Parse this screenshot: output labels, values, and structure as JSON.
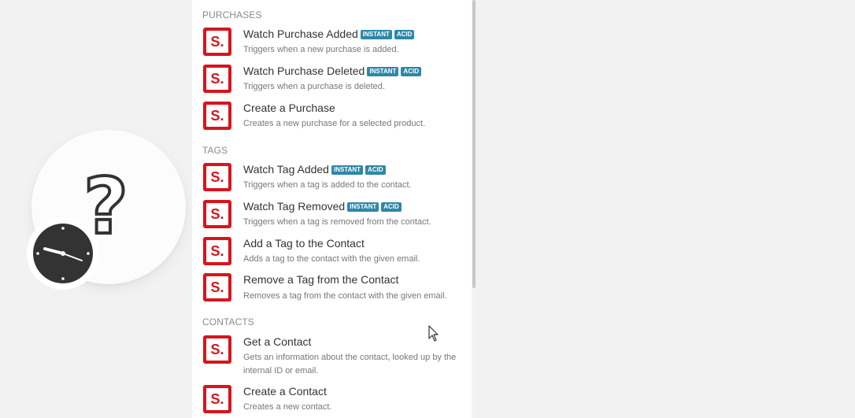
{
  "sections": {
    "purchases": "PURCHASES",
    "tags": "TAGS",
    "contacts": "CONTACTS"
  },
  "badges": {
    "instant": "INSTANT",
    "acid": "ACID"
  },
  "app_icon": {
    "glyph": "S.",
    "color": "#d9141b",
    "name": "sendfox-icon"
  },
  "modules": [
    {
      "title": "Watch Purchase Added",
      "desc": "Triggers when a new purchase is added."
    },
    {
      "title": "Watch Purchase Deleted",
      "desc": "Triggers when a purchase is deleted."
    },
    {
      "title": "Create a Purchase",
      "desc": "Creates a new purchase for a selected product."
    },
    {
      "title": "Watch Tag Added",
      "desc": "Triggers when a tag is added to the contact."
    },
    {
      "title": "Watch Tag Removed",
      "desc": "Triggers when a tag is removed from the contact."
    },
    {
      "title": "Add a Tag to the Contact",
      "desc": "Adds a tag to the contact with the given email."
    },
    {
      "title": "Remove a Tag from the Contact",
      "desc": "Removes a tag from the contact with the given email."
    },
    {
      "title": "Get a Contact",
      "desc": "Gets an information about the contact, looked up by the internal ID or email."
    },
    {
      "title": "Create a Contact",
      "desc": "Creates a new contact."
    }
  ],
  "module_bubble": {
    "icon": "question-mark-icon",
    "trigger_icon": "clock-icon"
  }
}
